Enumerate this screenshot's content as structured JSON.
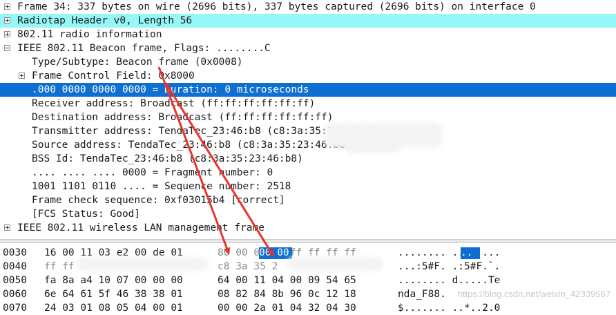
{
  "tree": [
    {
      "text": "Frame 34: 337 bytes on wire (2696 bits), 337 bytes captured (2696 bits) on interface 0",
      "level": 0,
      "expander": "plus",
      "style": "normal"
    },
    {
      "text": "Radiotap Header v0, Length 56",
      "level": 0,
      "expander": "plus",
      "style": "cyan"
    },
    {
      "text": "802.11 radio information",
      "level": 0,
      "expander": "plus",
      "style": "normal"
    },
    {
      "text": "IEEE 802.11 Beacon frame, Flags: ........C",
      "level": 0,
      "expander": "minus",
      "style": "normal"
    },
    {
      "text": "Type/Subtype: Beacon frame (0x0008)",
      "level": 1,
      "expander": "none",
      "style": "normal"
    },
    {
      "text": "Frame Control Field: 0x8000",
      "level": 1,
      "expander": "plus",
      "style": "normal"
    },
    {
      "text": ".000 0000 0000 0000 = Duration: 0 microseconds",
      "level": 1,
      "expander": "none",
      "style": "selected"
    },
    {
      "text": "Receiver address: Broadcast (ff:ff:ff:ff:ff:ff)",
      "level": 1,
      "expander": "none",
      "style": "normal"
    },
    {
      "text": "Destination address: Broadcast (ff:ff:ff:ff:ff:ff)",
      "level": 1,
      "expander": "none",
      "style": "normal"
    },
    {
      "text": "Transmitter address: TendaTec_23:46:b8 (c8:3a:35:23:46:b8)",
      "level": 1,
      "expander": "none",
      "style": "normal"
    },
    {
      "text": "Source address: TendaTec_23:46:b8 (c8:3a:35:23:46:b8)",
      "level": 1,
      "expander": "none",
      "style": "normal"
    },
    {
      "text": "BSS Id: TendaTec_23:46:b8 (c8:3a:35:23:46:b8)",
      "level": 1,
      "expander": "none",
      "style": "normal"
    },
    {
      "text": ".... .... .... 0000 = Fragment number: 0",
      "level": 1,
      "expander": "none",
      "style": "normal"
    },
    {
      "text": "1001 1101 0110 .... = Sequence number: 2518",
      "level": 1,
      "expander": "none",
      "style": "normal"
    },
    {
      "text": "Frame check sequence: 0xf03015b4 [correct]",
      "level": 1,
      "expander": "none",
      "style": "normal"
    },
    {
      "text": "[FCS Status: Good]",
      "level": 1,
      "expander": "none",
      "style": "normal"
    },
    {
      "text": "IEEE 802.11 wireless LAN management frame",
      "level": 0,
      "expander": "plus",
      "style": "normal"
    }
  ],
  "hex": [
    {
      "offset": "0030",
      "bytes1": "16 00 11 03 e2 00 de 01",
      "bytes2": "80 00 00 00 ff ff ff ff",
      "ascii": "........ ........"
    },
    {
      "offset": "0040",
      "bytes1": "ff ff",
      "bytes2": "c8 3a 35 2",
      "ascii": "...:5#F. .:5#F.`."
    },
    {
      "offset": "0050",
      "bytes1": "fa 8a a4 10 07 00 00 00",
      "bytes2": "64 00 11 04 00 09 54 65",
      "ascii": "........ d.....Te"
    },
    {
      "offset": "0060",
      "bytes1": "6e 64 61 5f 46 38 38 01",
      "bytes2": "08 82 84 8b 96 0c 12 18",
      "ascii": "nda_F88."
    },
    {
      "offset": "0070",
      "bytes1": "24 03 01 08 05 04 00 01",
      "bytes2": "00 00 2a 01 04 32 04 30",
      "ascii": "$....... ..*..2.0"
    }
  ],
  "hex_selected": {
    "bytes": "00 00",
    "ascii": ".."
  },
  "watermark": "https://blog.csdn.net/weixin_42339567",
  "colors": {
    "selection": "#0d6fd1",
    "cyan_row": "#95f7f7",
    "arrow": "#e8342c"
  }
}
